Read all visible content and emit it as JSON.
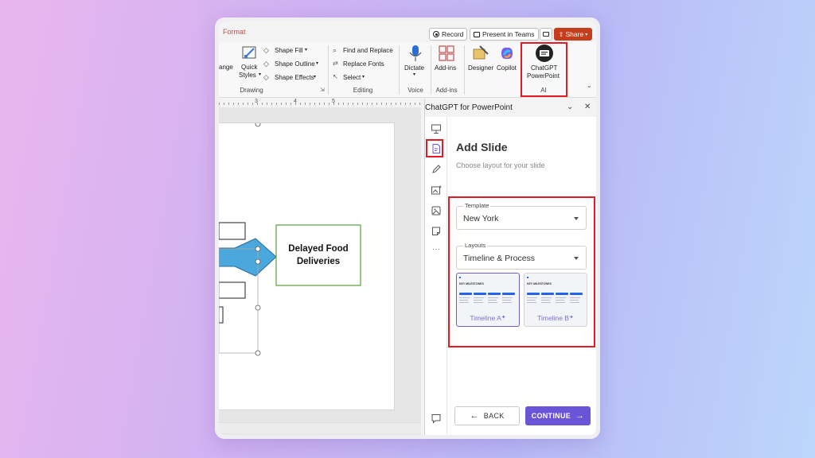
{
  "titlebar": {
    "format_tab": "Format",
    "record": "Record",
    "present_in_teams": "Present in Teams",
    "share": "Share"
  },
  "ribbon": {
    "arrange_partial": "ange",
    "quick_styles_1": "Quick",
    "quick_styles_2": "Styles",
    "shape_fill": "Shape Fill",
    "shape_outline": "Shape Outline",
    "shape_effects": "Shape Effects",
    "find_replace": "Find and Replace",
    "replace_fonts": "Replace Fonts",
    "select": "Select",
    "dictate": "Dictate",
    "addins": "Add-ins",
    "designer": "Designer",
    "copilot": "Copilot",
    "chatgpt_1": "ChatGPT",
    "chatgpt_2": "PowerPoint",
    "groups": {
      "drawing": "Drawing",
      "editing": "Editing",
      "voice": "Voice",
      "addins": "Add-ins",
      "ai": "AI"
    }
  },
  "ruler": {
    "marks": [
      "3",
      "4",
      "5"
    ]
  },
  "slide": {
    "box_text_line1": "Delayed Food",
    "box_text_line2": "Deliveries"
  },
  "pane": {
    "title": "ChatGPT for PowerPoint",
    "heading": "Add Slide",
    "subheading": "Choose layout for your slide",
    "template_label": "Template",
    "template_value": "New York",
    "layouts_label": "Layouts",
    "layouts_value": "Timeline & Process",
    "thumbs": [
      {
        "label": "Timeline A",
        "header": "KEY MILESTONES"
      },
      {
        "label": "Timeline B",
        "header": "KEY MILESTONES"
      }
    ],
    "back": "BACK",
    "continue": "CONTINUE"
  },
  "colors": {
    "share": "#c43e1c",
    "continue": "#6a55d8",
    "highlight": "#e01b24",
    "arrow": "#4aa8dc",
    "box_border": "#5a9e3c"
  }
}
